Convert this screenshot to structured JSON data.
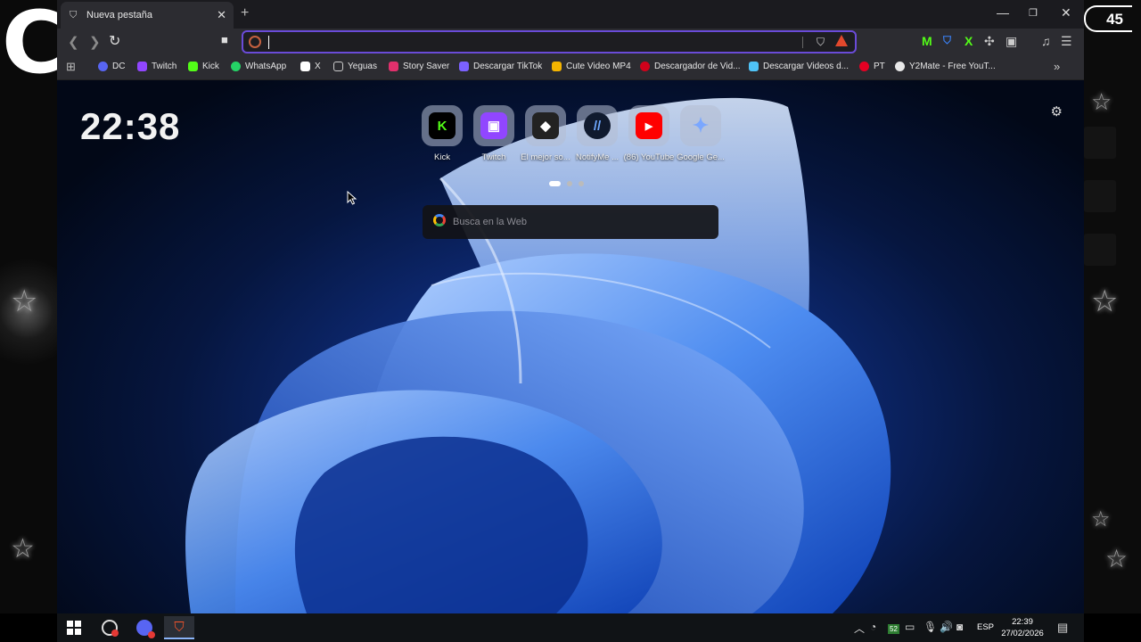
{
  "overlay": {
    "channel_letter": "C",
    "viewer_count": "45"
  },
  "browser": {
    "tab_title": "Nueva pestaña",
    "new_tab_symbol": "+",
    "window_controls": {
      "minimize": "—",
      "maximize": "❐",
      "close": "✕"
    },
    "omnibox_value": ""
  },
  "bookmarks": [
    {
      "label": "DC",
      "icon": "discord-icon",
      "color": "#5865f2"
    },
    {
      "label": "Twitch",
      "icon": "twitch-icon",
      "color": "#9146ff"
    },
    {
      "label": "Kick",
      "icon": "kick-icon",
      "color": "#53fc18"
    },
    {
      "label": "WhatsApp",
      "icon": "whatsapp-icon",
      "color": "#25d366"
    },
    {
      "label": "X",
      "icon": "x-icon",
      "color": "#ffffff"
    },
    {
      "label": "Yeguas",
      "icon": "folder-icon",
      "color": "#cccccc"
    },
    {
      "label": "Story Saver",
      "icon": "instagram-icon",
      "color": "#e1306c"
    },
    {
      "label": "Descargar TikTok",
      "icon": "tiktok-icon",
      "color": "#7b61ff"
    },
    {
      "label": "Cute Video MP4",
      "icon": "video-icon",
      "color": "#f4b400"
    },
    {
      "label": "Descargador de Vid...",
      "icon": "download-icon",
      "color": "#d0021b"
    },
    {
      "label": "Descargar Videos d...",
      "icon": "download-icon",
      "color": "#4fc3f7"
    },
    {
      "label": "PT",
      "icon": "pinterest-icon",
      "color": "#e60023"
    },
    {
      "label": "Y2Mate - Free YouT...",
      "icon": "y2mate-icon",
      "color": "#e8e8e8"
    }
  ],
  "new_tab_page": {
    "clock": "22:38",
    "search_placeholder": "Busca en la Web",
    "sites": [
      {
        "label": "Kick",
        "icon": "kick-icon",
        "color": "#53fc18",
        "glyph": "K"
      },
      {
        "label": "Twitch",
        "icon": "twitch-icon",
        "color": "#9146ff",
        "glyph": "▣"
      },
      {
        "label": "El mejor so...",
        "icon": "discord-bot-icon",
        "color": "#222222",
        "glyph": "◆"
      },
      {
        "label": "NotifyMe ...",
        "icon": "notifyme-icon",
        "color": "#101a2e",
        "glyph": "//"
      },
      {
        "label": "(86) YouTube",
        "icon": "youtube-icon",
        "color": "#ff0000",
        "glyph": "▶"
      },
      {
        "label": "Google Ge...",
        "icon": "gemini-icon",
        "color": "#7aa7ff",
        "glyph": "✦"
      }
    ]
  },
  "taskbar": {
    "tray_badge": "52",
    "language": "ESP",
    "time": "22:39",
    "date": "27/02/2026"
  }
}
